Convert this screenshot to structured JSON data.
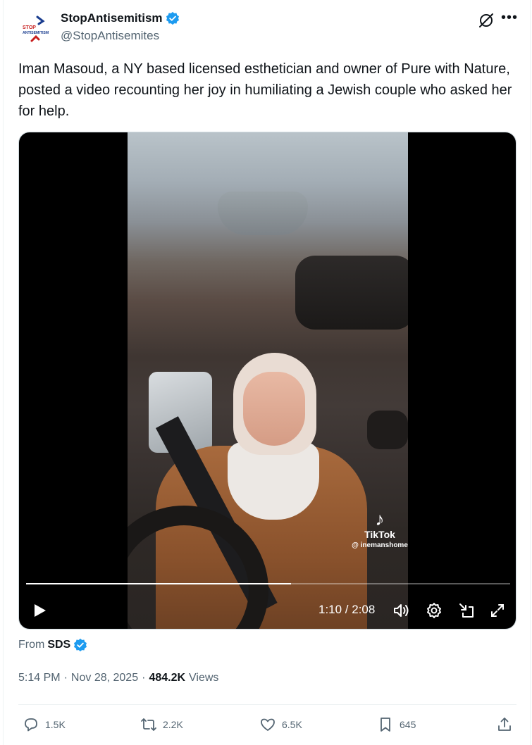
{
  "post": {
    "author": {
      "display_name": "StopAntisemitism",
      "handle": "@StopAntisemites",
      "verified": true,
      "avatar_icon": "stop-antisemitism-logo",
      "avatar_text": "STOP ANTISEMITISM"
    },
    "text": "Iman Masoud, a NY based licensed esthetician and owner of Pure with Nature, posted a video recounting her joy in humiliating a Jewish couple who asked her for help."
  },
  "video": {
    "watermark_label": "TikTok",
    "watermark_user": "@ inemanshome",
    "time_display": "1:10 / 2:08",
    "progress": 0.547,
    "controls": [
      "play-icon",
      "volume-icon",
      "settings-icon",
      "pop-out-icon",
      "fullscreen-icon"
    ]
  },
  "source": {
    "from_label": "From",
    "name": "SDS",
    "verified": true
  },
  "meta": {
    "time": "5:14 PM",
    "separator": "·",
    "date": "Nov 28, 2025",
    "views_count": "484.2K",
    "views_label": "Views"
  },
  "actions": {
    "replies": "1.5K",
    "reposts": "2.2K",
    "likes": "6.5K",
    "bookmarks": "645"
  },
  "colors": {
    "text_primary": "#0f1419",
    "text_secondary": "#536471",
    "verified_blue": "#1d9bf0",
    "border": "#eff3f4"
  }
}
